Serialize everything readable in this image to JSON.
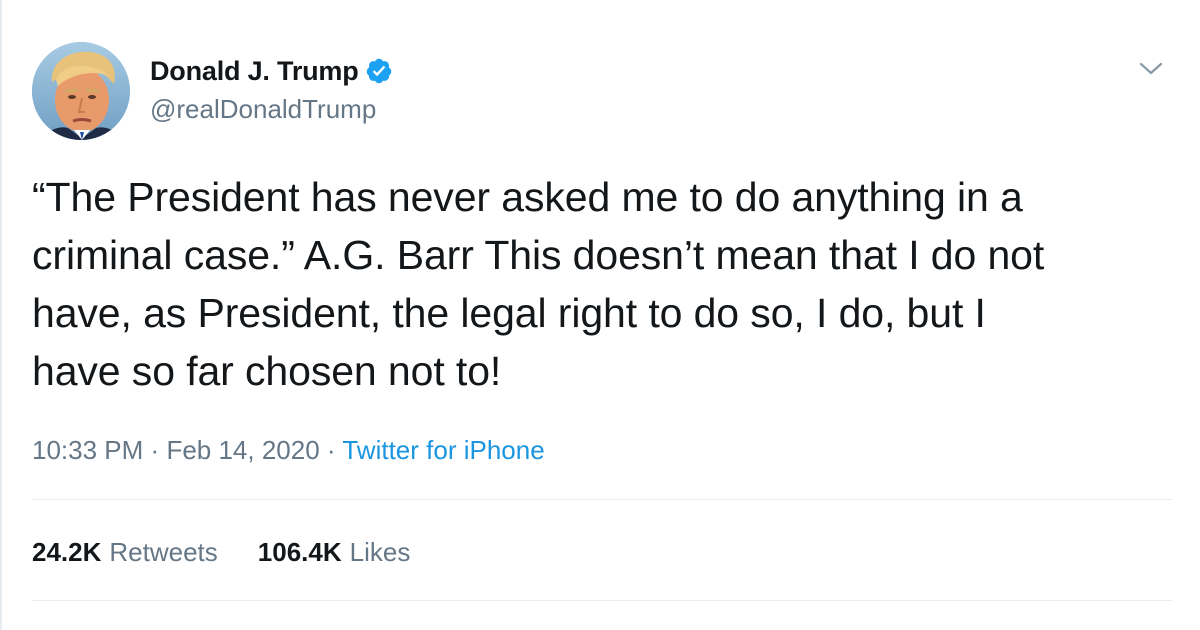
{
  "user": {
    "display_name": "Donald J. Trump",
    "handle": "@realDonaldTrump",
    "verified": true,
    "verified_color": "#1da1f2"
  },
  "tweet": {
    "text": "“The President has never asked me to do anything in a\ncriminal case.” A.G. Barr  This doesn’t mean that I do not\nhave, as President, the legal right to do so, I do, but I\nhave so far chosen not to!",
    "time": "10:33 PM",
    "separator": "·",
    "date": "Feb 14, 2020",
    "source": "Twitter for iPhone"
  },
  "stats": {
    "retweets_count": "24.2K",
    "retweets_label": "Retweets",
    "likes_count": "106.4K",
    "likes_label": "Likes"
  },
  "colors": {
    "text": "#14171a",
    "secondary": "#657786",
    "link": "#1b95e0",
    "divider": "#e6ecf0"
  },
  "icons": {
    "verified": "verified-badge-icon",
    "menu": "chevron-down-icon"
  }
}
